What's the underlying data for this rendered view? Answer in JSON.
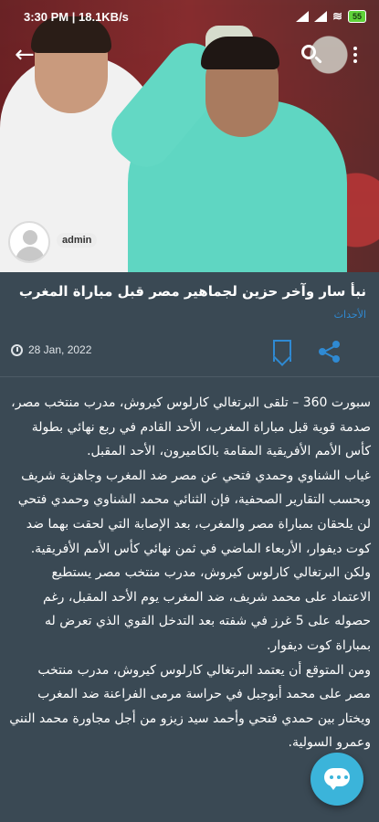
{
  "status_bar": {
    "time": "3:30 PM | 18.1KB/s",
    "battery": "55"
  },
  "author": {
    "name": "admin"
  },
  "article": {
    "title": "نبأ سار وآخر حزين لجماهير مصر قبل مباراة المغرب",
    "category": "الأحداث",
    "date": "28 Jan, 2022",
    "paragraphs": [
      "سبورت 360 – تلقى البرتغالي كارلوس كيروش، مدرب منتخب مصر، صدمة قوية قبل مباراة المغرب، الأحد القادم في ربع نهائي بطولة كأس الأمم الأفريقية المقامة بالكاميرون، الأحد المقبل.",
      "غياب الشناوي وحمدي فتحي عن مصر ضد المغرب وجاهزية شريف وبحسب التقارير الصحفية، فإن الثنائي محمد الشناوي وحمدي فتحي لن يلحقان بمباراة مصر والمغرب، بعد الإصابة التي لحقت بهما ضد كوت ديفوار، الأربعاء الماضي في ثمن نهائي كأس الأمم الأفريقية.",
      "ولكن البرتغالي كارلوس كيروش، مدرب منتخب مصر يستطيع الاعتماد على محمد شريف، ضد المغرب يوم الأحد المقبل، رغم حصوله على 5 غرز في شفته بعد التدخل القوي الذي تعرض له بمباراة كوت ديفوار.",
      "ومن المتوقع أن يعتمد البرتغالي كارلوس كيروش، مدرب منتخب مصر على محمد أبوجبل في حراسة مرمى الفراعنة ضد المغرب ويختار بين حمدي فتحي وأحمد سيد زيزو من أجل مجاورة محمد النني وعمرو السولية."
    ]
  },
  "icons": {
    "back": "arrow-left-icon",
    "search": "search-icon",
    "more": "more-vert-icon",
    "clock": "clock-icon",
    "bookmark": "bookmark-icon",
    "share": "share-icon",
    "fab": "chat-icon"
  },
  "colors": {
    "background": "#3a4954",
    "accent": "#2f8ad3",
    "fab": "#3bb4da"
  }
}
